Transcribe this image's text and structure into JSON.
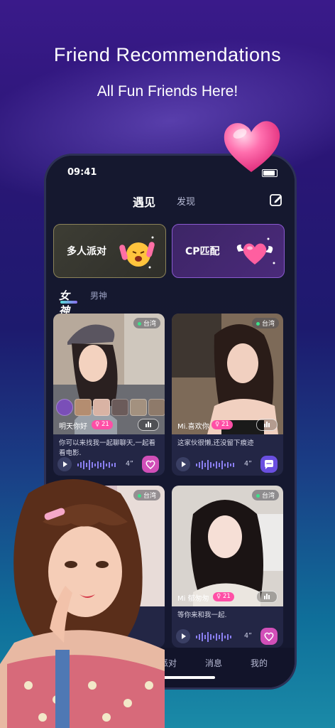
{
  "promo": {
    "headline": "Friend Recommendations",
    "subline": "All Fun Friends Here!"
  },
  "status_bar": {
    "time": "09:41"
  },
  "nav": {
    "tab_meet": "遇见",
    "tab_discover": "发现",
    "edit_icon": "edit-icon"
  },
  "feature_cards": {
    "party": "多人派对",
    "cp": "CP匹配"
  },
  "category_tabs": {
    "female": "女神",
    "male": "男神"
  },
  "profiles": [
    {
      "location": "台湾",
      "name": "明天你好",
      "age": "21",
      "bio": "你可以来找我一起聊聊天,一起看看电影.",
      "duration": "4”",
      "action_icon": "heart-icon"
    },
    {
      "location": "台湾",
      "name": "Mi.喜欢你",
      "age": "21",
      "bio": "这家伙很懒,还没留下痕迹",
      "duration": "4”",
      "action_icon": "chat-icon"
    },
    {
      "location": "台湾",
      "name": "",
      "age": "",
      "bio": "",
      "duration": "",
      "action_icon": ""
    },
    {
      "location": "台湾",
      "name": "Mi 郁匆匆",
      "age": "21",
      "bio": "等你来和我一起.",
      "duration": "4”",
      "action_icon": "heart-icon"
    }
  ],
  "tabbar": {
    "party": "派对",
    "messages": "消息",
    "mine": "我的"
  },
  "colors": {
    "accent_pink": "#ff4fa6",
    "accent_purple": "#8b6cf0",
    "online_green": "#3ee08a"
  }
}
